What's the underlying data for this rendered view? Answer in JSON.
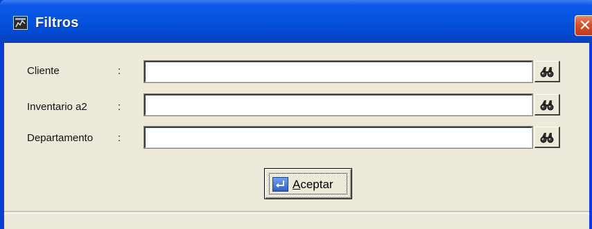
{
  "window": {
    "title": "Filtros",
    "close_symbol": "✕",
    "title_icon": "window-app-icon",
    "title_bar_color": "#0454e0",
    "close_button_color": "#d6502c"
  },
  "fields": [
    {
      "label": "Cliente",
      "colon": ":",
      "value": "",
      "lookup_icon": "binoculars-search-icon"
    },
    {
      "label": "Inventario a2",
      "colon": ":",
      "value": "",
      "lookup_icon": "binoculars-search-icon"
    },
    {
      "label": "Departamento",
      "colon": ":",
      "value": "",
      "lookup_icon": "binoculars-search-icon"
    }
  ],
  "accept_button": {
    "label_first": "A",
    "label_rest": "ceptar",
    "icon": "enter-key-icon"
  }
}
